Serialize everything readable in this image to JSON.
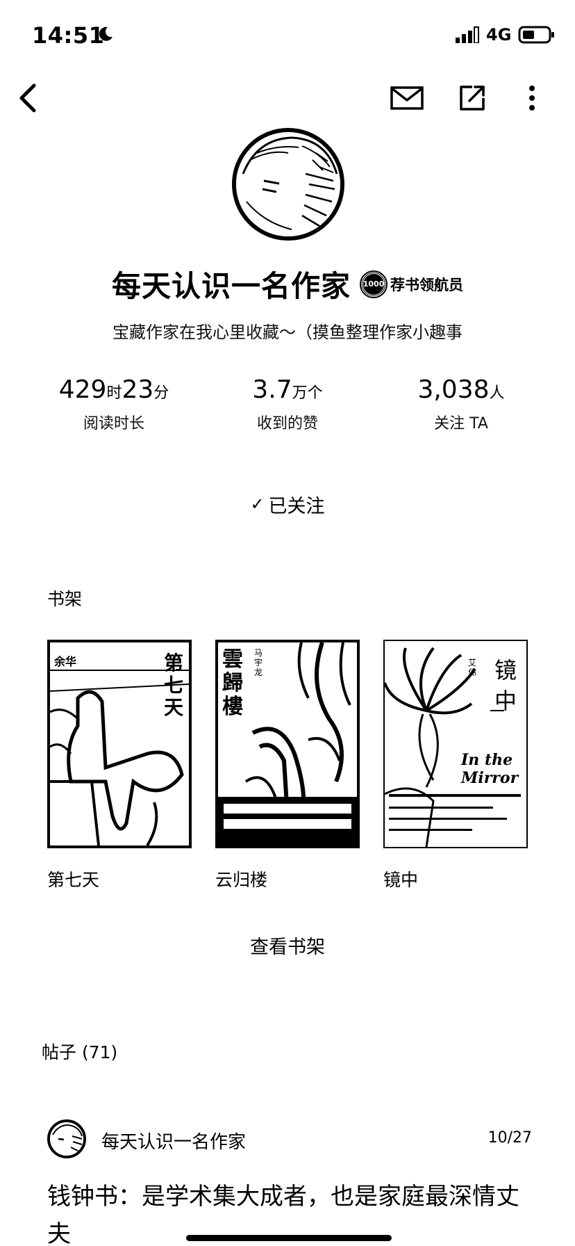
{
  "status_bar": {
    "time": "14:51",
    "network": "4G"
  },
  "profile": {
    "name": "每天认识一名作家",
    "badge_number": "1000",
    "badge_title": "荐书领航员",
    "bio": "宝藏作家在我心里收藏～（摸鱼整理作家小趣事"
  },
  "stats": [
    {
      "num1": "429",
      "unit1": "时",
      "num2": "23",
      "unit2": "分",
      "label": "阅读时长"
    },
    {
      "num1": "3.7",
      "unit1": "万个",
      "num2": "",
      "unit2": "",
      "label": "收到的赞"
    },
    {
      "num1": "3,038",
      "unit1": "人",
      "num2": "",
      "unit2": "",
      "label": "关注 TA"
    }
  ],
  "follow": {
    "check": "✓",
    "label": "已关注"
  },
  "bookshelf": {
    "title": "书架",
    "books": [
      {
        "title": "第七天",
        "cover_title": "第七天",
        "cover_author": "余华"
      },
      {
        "title": "云归楼",
        "cover_title": "雲歸樓",
        "cover_author": "马宇龙"
      },
      {
        "title": "镜中",
        "cover_title": "镜中",
        "cover_author": "艾伟",
        "cover_en_1": "In the",
        "cover_en_2": "Mirror"
      }
    ],
    "view_all": "查看书架"
  },
  "posts": {
    "title": "帖子 (71)",
    "items": [
      {
        "author": "每天认识一名作家",
        "date": "10/27",
        "title": "钱钟书：是学术集大成者，也是家庭最深情丈夫"
      }
    ]
  }
}
